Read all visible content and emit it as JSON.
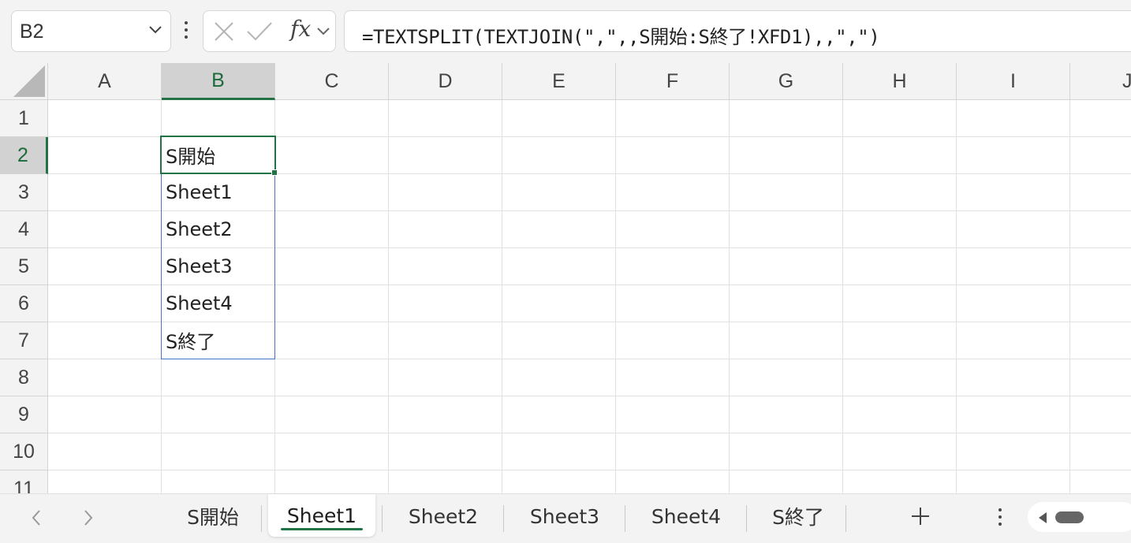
{
  "formula_bar": {
    "name_box": "B2",
    "fx": "fx",
    "formula": "=TEXTSPLIT(TEXTJOIN(\",\",,S開始:S終了!XFD1),,\",\")"
  },
  "columns": [
    "A",
    "B",
    "C",
    "D",
    "E",
    "F",
    "G",
    "H",
    "I",
    "J"
  ],
  "active_column": "B",
  "rows": [
    "1",
    "2",
    "3",
    "4",
    "5",
    "6",
    "7",
    "8",
    "9",
    "10",
    "11"
  ],
  "active_row": "2",
  "cells": {
    "B2": "S開始",
    "B3": "Sheet1",
    "B4": "Sheet2",
    "B5": "Sheet3",
    "B6": "Sheet4",
    "B7": "S終了"
  },
  "sheet_tabs": [
    "S開始",
    "Sheet1",
    "Sheet2",
    "Sheet3",
    "Sheet4",
    "S終了"
  ],
  "active_sheet": "Sheet1",
  "colors": {
    "accent": "#217346",
    "spill_border": "#4472c4",
    "header_bg": "#f3f3f3",
    "active_header_bg": "#d2d2d2"
  }
}
